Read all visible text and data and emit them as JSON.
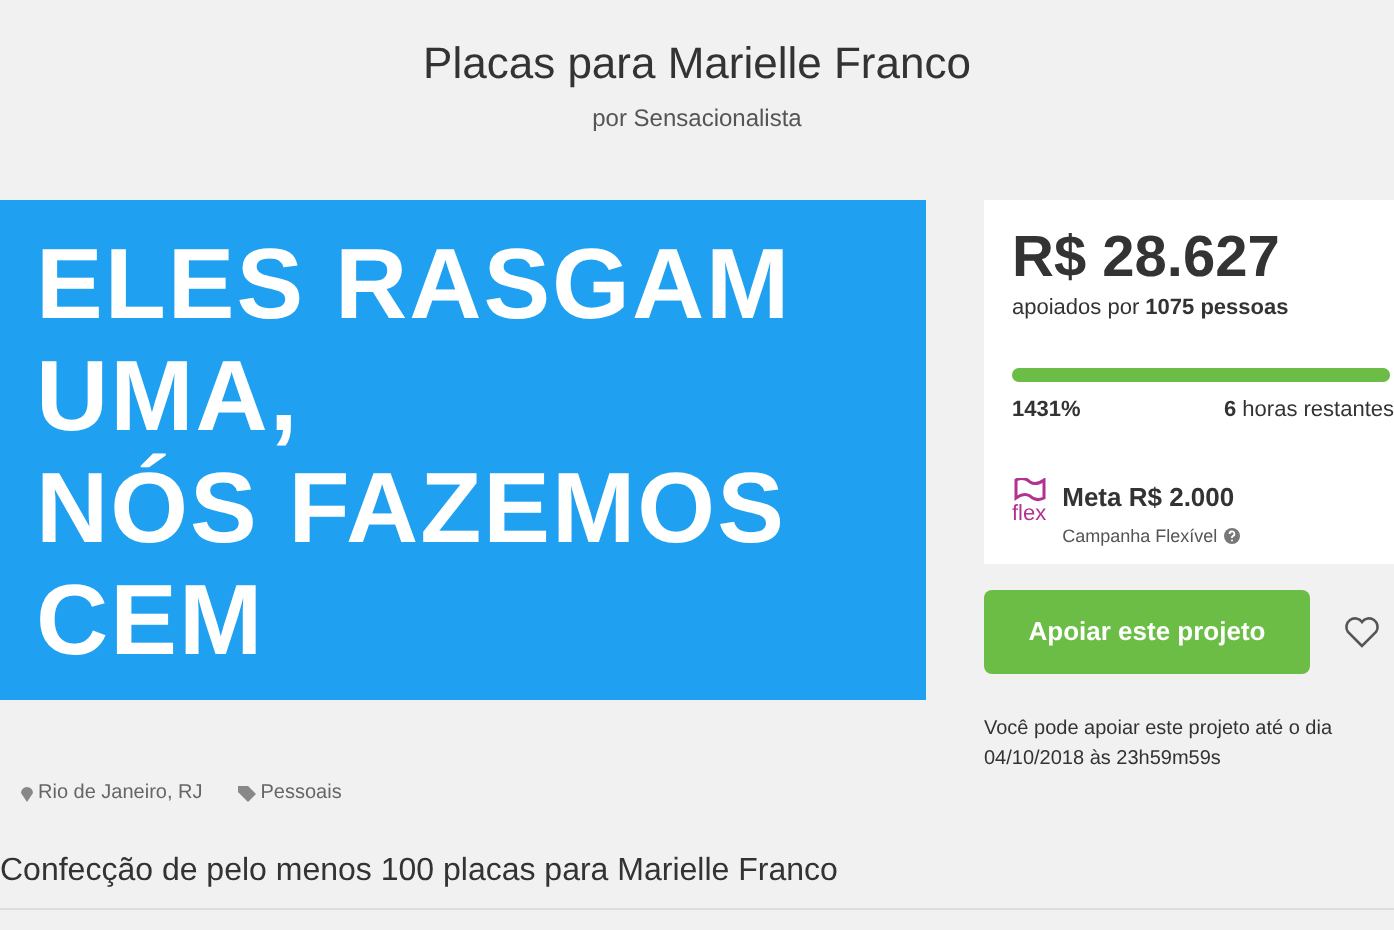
{
  "title": "Placas para Marielle Franco",
  "author": "por Sensacionalista",
  "banner": {
    "lines": [
      "ELES RASGAM",
      "UMA,",
      "NÓS FAZEMOS",
      "CEM"
    ]
  },
  "stats": {
    "amount": "R$ 28.627",
    "backers_prefix": "apoiados por",
    "backers_count": "1075 pessoas",
    "level": 1,
    "percent": "1431%",
    "time_value": "6",
    "time_label": "horas restantes",
    "flex_label": "flex",
    "goal": "Meta R$ 2.000",
    "campaign_type": "Campanha Flexível"
  },
  "support_button": "Apoiar este projeto",
  "favorite": {
    "selected": false
  },
  "deadline": "Você pode apoiar este projeto até o dia 04/10/2018 às 23h59m59s",
  "location": "Rio de Janeiro, RJ",
  "category": "Pessoais",
  "subtitle": "Confecção de pelo menos 100 placas para Marielle Franco"
}
